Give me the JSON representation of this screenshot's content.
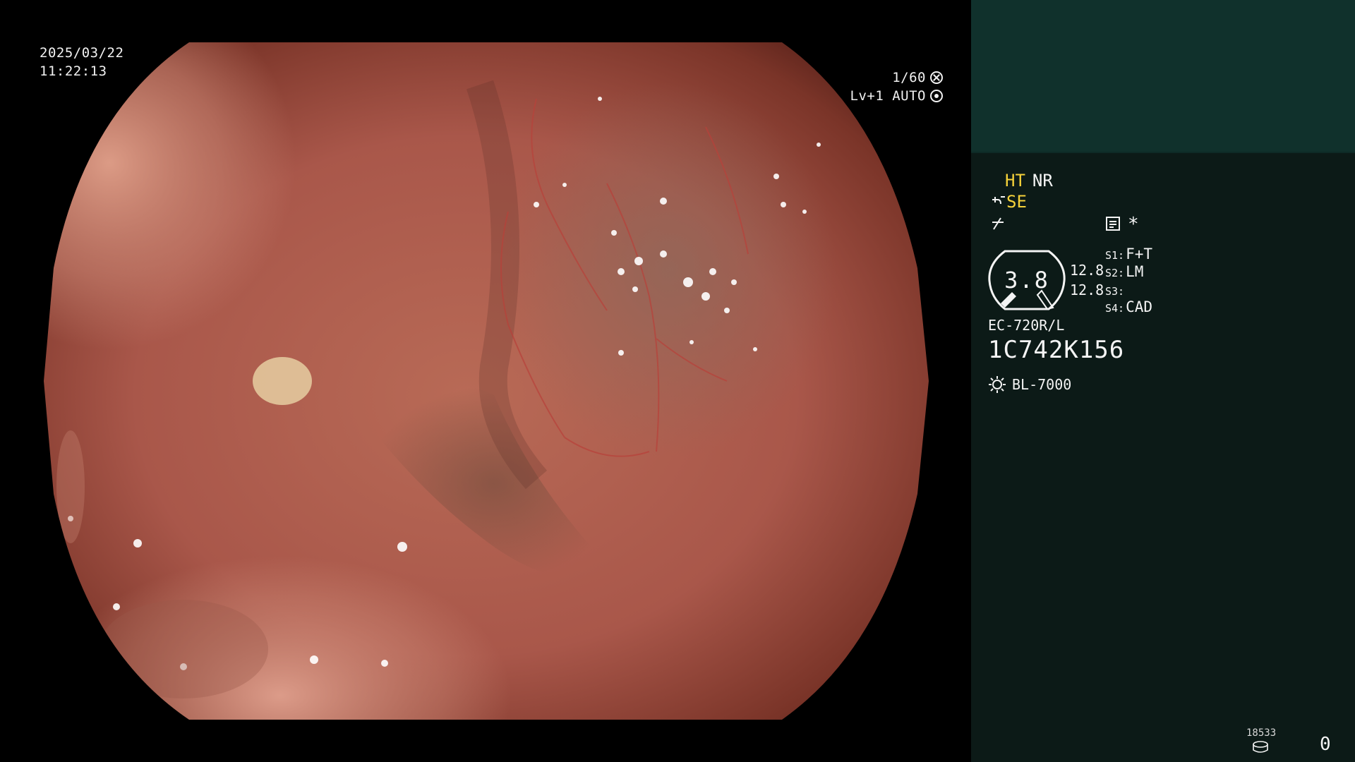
{
  "overlay": {
    "date": "2025/03/22",
    "time": "11:22:13",
    "shutter": "1/60",
    "shutter_icon": "shutter-icon",
    "level_mode": "Lv+1 AUTO",
    "iris_icon": "iris-icon"
  },
  "panel": {
    "modes": {
      "ht": "HT",
      "nr": "NR",
      "se": "SE",
      "row2_icon": "structure-enhancement-icon",
      "row3_icon": "color-enhancement-icon"
    },
    "memo_icon": "memo-icon",
    "asterisk": "*",
    "zoom": {
      "value": "3.8",
      "mag_1": "12.8",
      "mag_2": "12.8"
    },
    "switches": [
      {
        "key": "S1:",
        "value": "F+T"
      },
      {
        "key": "S2:",
        "value": "LM"
      },
      {
        "key": "S3:",
        "value": ""
      },
      {
        "key": "S4:",
        "value": "CAD"
      }
    ],
    "scope": {
      "model": "EC-720R/L",
      "serial": "1C742K156"
    },
    "light_source": {
      "icon": "lamp-icon",
      "label": "BL-7000"
    },
    "counter_small": "18533",
    "counter_big": "0",
    "storage_icon": "storage-icon"
  },
  "colors": {
    "panel_bg": "#0c1a17",
    "panel_header": "#10312c",
    "highlight": "#f6d23a",
    "text": "#f4f4f4"
  }
}
